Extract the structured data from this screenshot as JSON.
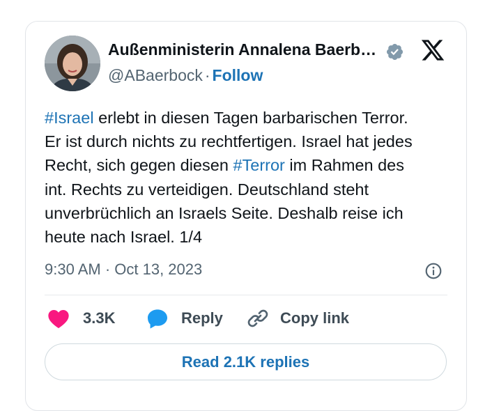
{
  "author": {
    "name": "Außenministerin Annalena Baerb…",
    "handle": "@ABaerbock",
    "separator": "·",
    "follow_label": "Follow"
  },
  "tweet": {
    "lines": [
      {
        "hashtag": "#Israel",
        "text": " erlebt in diesen Tagen barbarischen Terror."
      },
      {
        "text": "Er ist durch nichts zu rechtfertigen. Israel hat jedes"
      },
      {
        "before": "Recht, sich gegen diesen ",
        "hashtag": "#Terror",
        "after": " im Rahmen des"
      },
      {
        "text": "int. Rechts zu verteidigen. Deutschland steht"
      },
      {
        "text": "unverbrüchlich an Israels Seite. Deshalb reise ich"
      },
      {
        "text": "heute nach Israel. 1/4"
      }
    ]
  },
  "timestamp": "9:30 AM · Oct 13, 2023",
  "actions": {
    "like_count": "3.3K",
    "reply_label": "Reply",
    "copy_label": "Copy link"
  },
  "read_replies_label": "Read 2.1K replies",
  "icons": {
    "verified": "verified-badge-icon",
    "x_logo": "x-logo-icon",
    "info": "info-icon",
    "heart": "heart-icon",
    "reply": "reply-bubble-icon",
    "link": "link-icon"
  },
  "colors": {
    "link_blue": "#1d73b5",
    "heart_pink": "#f91880",
    "reply_blue": "#1d9bf0",
    "verified_gray": "#829aab",
    "muted_text": "#536471"
  }
}
